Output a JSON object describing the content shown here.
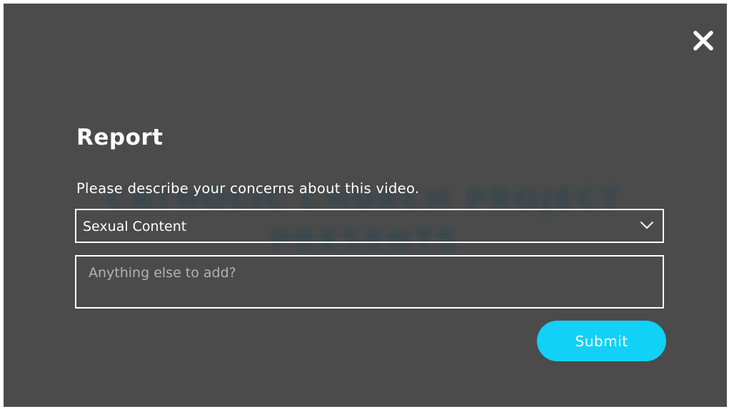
{
  "background": {
    "blurred_text_lines": [
      "CATHOLIC CHURCH PROJECT",
      "PRESENTS"
    ]
  },
  "dialog": {
    "close_icon": "close-icon",
    "title": "Report",
    "description": "Please describe your concerns about this video.",
    "reason_select": {
      "selected_value": "Sexual Content",
      "icon": "chevron-down-icon"
    },
    "details_field": {
      "value": "",
      "placeholder": "Anything else to add?"
    },
    "submit_label": "Submit"
  },
  "colors": {
    "overlay": "#4b4b4b",
    "accent": "#11d1f7",
    "text": "#ffffff",
    "placeholder": "#b3b3b3"
  }
}
